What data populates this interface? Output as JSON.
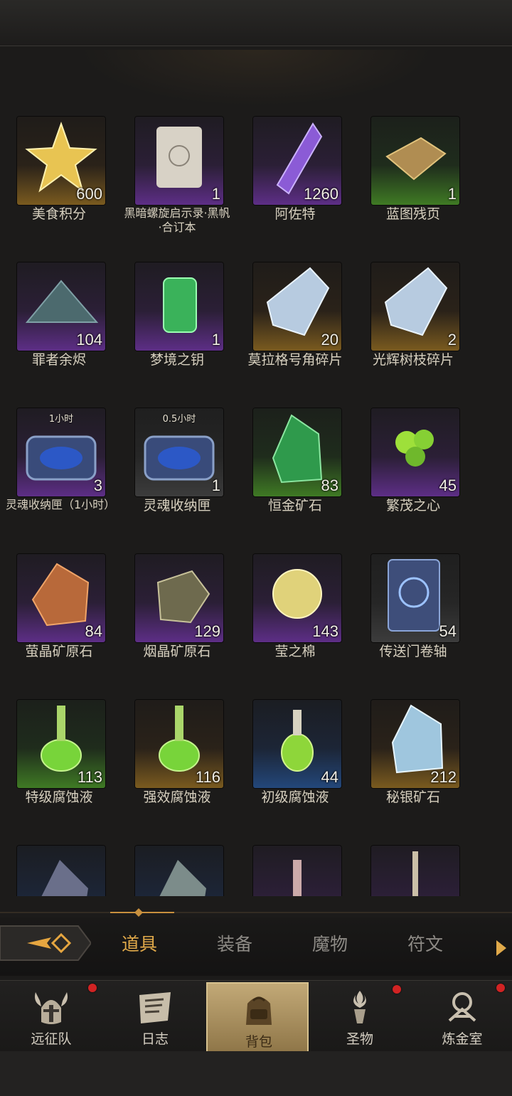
{
  "items": [
    {
      "name": "美食积分",
      "qty": "600",
      "rarity": "gold",
      "icon": "golden-star-icon"
    },
    {
      "name": "黑暗螺旋启示录·黑帆·合订本",
      "qty": "1",
      "rarity": "purple",
      "icon": "scroll-icon"
    },
    {
      "name": "阿佐特",
      "qty": "1260",
      "rarity": "purple",
      "icon": "purple-crystal-icon"
    },
    {
      "name": "蓝图残页",
      "qty": "1",
      "rarity": "green",
      "icon": "parchment-icon"
    },
    {
      "name": "罪者余烬",
      "qty": "104",
      "rarity": "purple",
      "icon": "ember-pile-icon"
    },
    {
      "name": "梦境之钥",
      "qty": "1",
      "rarity": "purple",
      "icon": "green-lantern-icon"
    },
    {
      "name": "莫拉格号角碎片",
      "qty": "20",
      "rarity": "gold",
      "icon": "ice-shard-icon"
    },
    {
      "name": "光辉树枝碎片",
      "qty": "2",
      "rarity": "gold",
      "icon": "ice-shard-icon"
    },
    {
      "name": "灵魂收纳匣（1小时）",
      "qty": "3",
      "rarity": "purple",
      "icon": "soul-chest-icon",
      "timer": "1小时"
    },
    {
      "name": "灵魂收纳匣",
      "qty": "1",
      "rarity": "gray",
      "icon": "soul-chest-icon",
      "timer": "0.5小时"
    },
    {
      "name": "恒金矿石",
      "qty": "83",
      "rarity": "green",
      "icon": "green-ore-icon"
    },
    {
      "name": "繁茂之心",
      "qty": "45",
      "rarity": "purple",
      "icon": "green-pods-icon"
    },
    {
      "name": "萤晶矿原石",
      "qty": "84",
      "rarity": "purple",
      "icon": "amber-rock-icon"
    },
    {
      "name": "烟晶矿原石",
      "qty": "129",
      "rarity": "purple",
      "icon": "smoky-rock-icon"
    },
    {
      "name": "莹之棉",
      "qty": "143",
      "rarity": "purple",
      "icon": "cotton-ball-icon"
    },
    {
      "name": "传送门卷轴",
      "qty": "54",
      "rarity": "gray",
      "icon": "portal-scroll-icon"
    },
    {
      "name": "特级腐蚀液",
      "qty": "113",
      "rarity": "green",
      "icon": "green-potion-icon"
    },
    {
      "name": "强效腐蚀液",
      "qty": "116",
      "rarity": "gold",
      "icon": "green-potion-icon"
    },
    {
      "name": "初级腐蚀液",
      "qty": "44",
      "rarity": "blue",
      "icon": "green-flask-icon"
    },
    {
      "name": "秘银矿石",
      "qty": "212",
      "rarity": "gold",
      "icon": "silver-ore-icon"
    },
    {
      "name": "",
      "qty": "",
      "rarity": "blue",
      "icon": "dark-ore-icon"
    },
    {
      "name": "",
      "qty": "",
      "rarity": "blue",
      "icon": "gray-ore-icon"
    },
    {
      "name": "",
      "qty": "",
      "rarity": "purple",
      "icon": "red-potion-icon"
    },
    {
      "name": "",
      "qty": "",
      "rarity": "purple",
      "icon": "red-vial-icon"
    }
  ],
  "tabs": [
    "道具",
    "装备",
    "魔物",
    "符文"
  ],
  "active_tab": "道具",
  "nav": [
    {
      "label": "远征队",
      "icon": "viking-helmet-icon",
      "badge": true
    },
    {
      "label": "日志",
      "icon": "journal-icon",
      "badge": false
    },
    {
      "label": "背包",
      "icon": "backpack-icon",
      "badge": false,
      "active": true
    },
    {
      "label": "圣物",
      "icon": "torch-icon",
      "badge": true
    },
    {
      "label": "炼金室",
      "icon": "alchemy-icon",
      "badge": true
    }
  ],
  "colors": {
    "accent": "#e0a94a",
    "rarity_gold": "#7a5a1f",
    "rarity_purple": "#5d2e86",
    "rarity_green": "#3f7a24",
    "rarity_blue": "#23477a",
    "badge": "#d12323"
  }
}
